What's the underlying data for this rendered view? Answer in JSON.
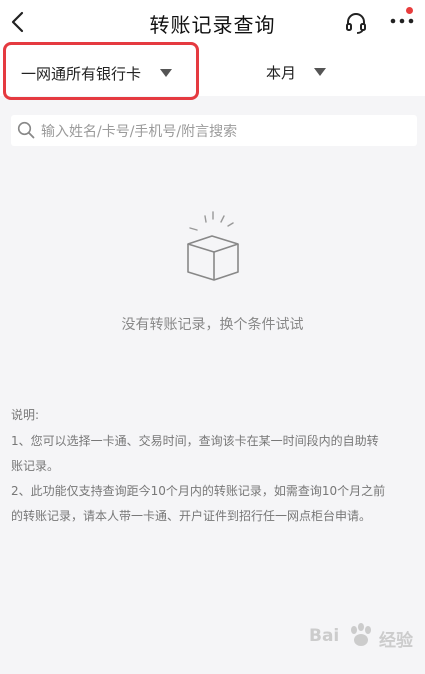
{
  "header": {
    "title": "转账记录查询",
    "back_icon": "back-arrow-icon",
    "service_icon": "headset-icon",
    "more_icon": "more-dots-icon"
  },
  "filters": {
    "card_selector": "一网通所有银行卡",
    "time_selector": "本月"
  },
  "search": {
    "value": "",
    "placeholder": "输入姓名/卡号/手机号/附言搜索"
  },
  "empty_state": {
    "icon": "empty-box-icon",
    "message": "没有转账记录，换个条件试试"
  },
  "notes": {
    "title": "说明:",
    "line1a": "1、您可以选择一卡通、交易时间，查询该卡在某一时间段内的自助转",
    "line1b": "账记录。",
    "line2a": "2、此功能仅支持查询距今10个月内的转账记录，如需查询10个月之前",
    "line2b": "的转账记录，请本人带一卡通、开户证件到招行任一网点柜台申请。"
  },
  "watermark": {
    "text_left": "Bai",
    "text_right": "经验"
  },
  "colors": {
    "highlight_border": "#e53a40",
    "notification_dot": "#e83d3d",
    "background": "#f5f5f7"
  }
}
